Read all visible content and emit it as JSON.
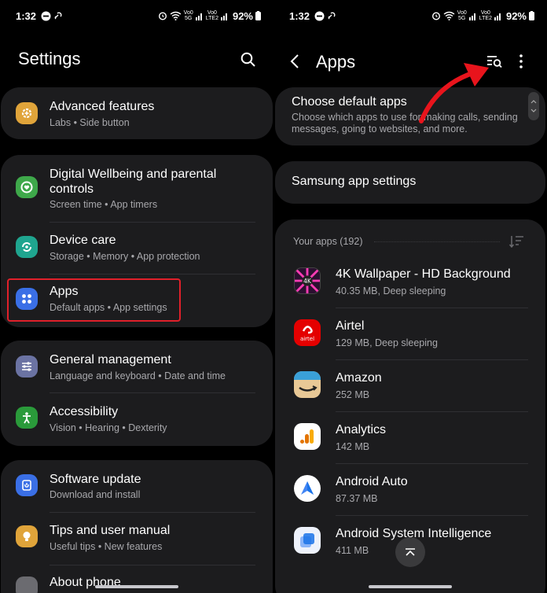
{
  "left": {
    "status": {
      "time": "1:32",
      "battery": "92%",
      "volte": "Vo0",
      "network1": "5G",
      "network2": "LTE2",
      "signal_tag": "Vo0"
    },
    "title": "Settings",
    "groups": [
      {
        "items": [
          {
            "title": "Advanced features",
            "subtitle": "Labs  •  Side button",
            "icon": "gear-plus-icon",
            "color": "#e0a43a"
          }
        ]
      },
      {
        "items": [
          {
            "title_line1": "Digital Wellbeing and parental",
            "title_line2": "controls",
            "subtitle": "Screen time  •  App timers",
            "icon": "wellbeing-icon",
            "color": "#3ea84a"
          },
          {
            "title": "Device care",
            "subtitle": "Storage  •  Memory  •  App protection",
            "icon": "device-care-icon",
            "color": "#1fa58f"
          },
          {
            "title": "Apps",
            "subtitle": "Default apps  •  App settings",
            "icon": "apps-grid-icon",
            "color": "#3a6fe6"
          }
        ]
      },
      {
        "items": [
          {
            "title": "General management",
            "subtitle": "Language and keyboard  •  Date and time",
            "icon": "sliders-icon",
            "color": "#6b73a3"
          },
          {
            "title": "Accessibility",
            "subtitle": "Vision  •  Hearing  •  Dexterity",
            "icon": "accessibility-icon",
            "color": "#2a9a3a"
          }
        ]
      },
      {
        "items": [
          {
            "title": "Software update",
            "subtitle": "Download and install",
            "icon": "software-update-icon",
            "color": "#3a6fe6"
          },
          {
            "title": "Tips and user manual",
            "subtitle": "Useful tips  •  New features",
            "icon": "lightbulb-icon",
            "color": "#e0a43a"
          },
          {
            "title": "About phone",
            "icon": "info-icon",
            "color": "#6b6b70"
          }
        ]
      }
    ]
  },
  "right": {
    "status": {
      "time": "1:32",
      "battery": "92%",
      "volte": "Vo0",
      "network1": "5G",
      "network2": "LTE2"
    },
    "title": "Apps",
    "default_apps": {
      "title": "Choose default apps",
      "desc_line1": "Choose which apps to use for making calls, sending",
      "desc_line2": "messages, going to websites, and more."
    },
    "samsung": {
      "title": "Samsung app settings"
    },
    "your_apps_label": "Your apps (192)",
    "apps": [
      {
        "name": "4K Wallpaper - HD Background",
        "info": "40.35 MB, Deep sleeping",
        "icon": "wallpaper-app-icon",
        "icon_text": "4K"
      },
      {
        "name": "Airtel",
        "info": "129 MB, Deep sleeping",
        "icon": "airtel-app-icon",
        "icon_text": "airtel"
      },
      {
        "name": "Amazon",
        "info": "252 MB",
        "icon": "amazon-app-icon"
      },
      {
        "name": "Analytics",
        "info": "142 MB",
        "icon": "analytics-app-icon"
      },
      {
        "name": "Android Auto",
        "info": "87.37 MB",
        "icon": "android-auto-app-icon"
      },
      {
        "name": "Android System Intelligence",
        "info": "411 MB",
        "icon": "android-system-intelligence-app-icon"
      }
    ]
  },
  "colors": {
    "card": "#1c1c1e",
    "highlight": "#e0202a",
    "arrow": "#e8141c",
    "subtext": "#a8a8ac"
  }
}
